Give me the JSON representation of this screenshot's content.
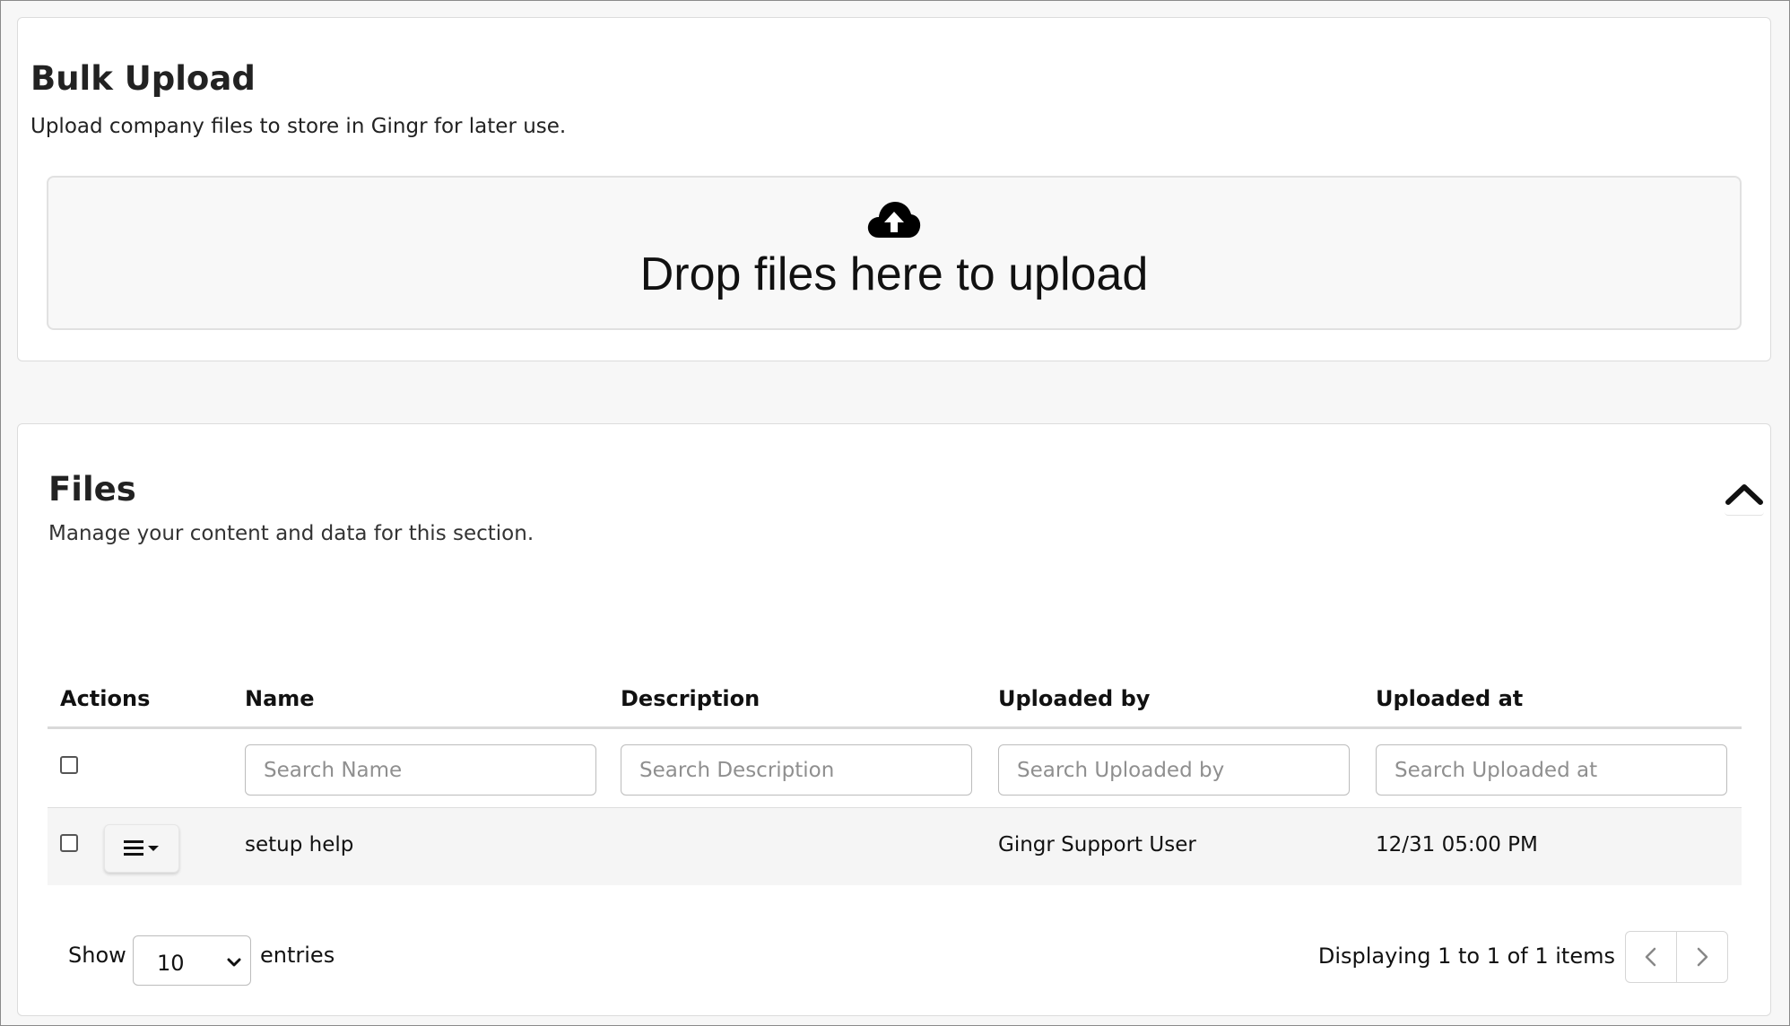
{
  "bulk_upload": {
    "title": "Bulk Upload",
    "subtitle": "Upload company files to store in Gingr for later use.",
    "dropzone_text": "Drop files here to upload",
    "dropzone_icon": "cloud-upload-icon"
  },
  "files": {
    "title": "Files",
    "subtitle": "Manage your content and data for this section.",
    "collapse_icon": "chevron-up-icon",
    "table": {
      "columns": [
        "Actions",
        "Name",
        "Description",
        "Uploaded by",
        "Uploaded at"
      ],
      "filters": {
        "name_placeholder": "Search Name",
        "description_placeholder": "Search Description",
        "uploaded_by_placeholder": "Search Uploaded by",
        "uploaded_at_placeholder": "Search Uploaded at"
      },
      "rows": [
        {
          "name": "setup help",
          "description": "",
          "uploaded_by": "Gingr Support User",
          "uploaded_at": "12/31 05:00 PM",
          "selected": false,
          "menu_icon": "hamburger-dropdown-icon"
        }
      ]
    },
    "footer": {
      "show_label": "Show",
      "page_size": "10",
      "entries_label": "entries",
      "info": "Displaying 1 to 1 of 1 items",
      "prev_icon": "chevron-left-icon",
      "next_icon": "chevron-right-icon"
    }
  }
}
